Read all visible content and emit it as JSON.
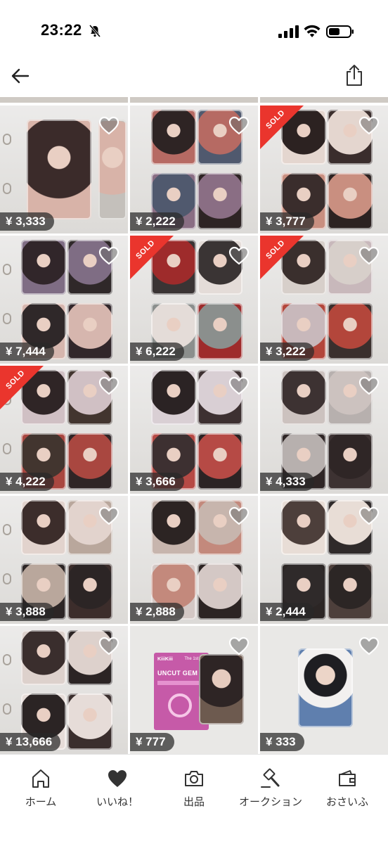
{
  "status_bar": {
    "time": "23:22"
  },
  "colors": {
    "sold_ribbon": "#ea352d",
    "price_tag_bg": "#3a3a3a",
    "heart_fill": "#ffffff",
    "heart_outline": "#666666"
  },
  "listings": [
    {
      "price": "¥ 3,333",
      "sold": false
    },
    {
      "price": "¥ 2,222",
      "sold": false
    },
    {
      "price": "¥ 3,777",
      "sold": true
    },
    {
      "price": "¥ 7,444",
      "sold": false
    },
    {
      "price": "¥ 6,222",
      "sold": true
    },
    {
      "price": "¥ 3,222",
      "sold": true
    },
    {
      "price": "¥ 4,222",
      "sold": true
    },
    {
      "price": "¥ 3,666",
      "sold": false
    },
    {
      "price": "¥ 4,333",
      "sold": false
    },
    {
      "price": "¥ 3,888",
      "sold": false
    },
    {
      "price": "¥ 2,888",
      "sold": false
    },
    {
      "price": "¥ 2,444",
      "sold": false
    },
    {
      "price": "¥ 13,666",
      "sold": false
    },
    {
      "price": "¥ 777",
      "sold": false
    },
    {
      "price": "¥ 333",
      "sold": false
    }
  ],
  "sold_label": "SOLD",
  "album": {
    "brand": "KiiiKiii",
    "ep": "The 1st EP",
    "title": "UNCUT GEM"
  },
  "tabs": [
    {
      "label": "ホーム",
      "icon": "home-icon"
    },
    {
      "label": "いいね！",
      "icon": "heart-icon"
    },
    {
      "label": "出品",
      "icon": "camera-icon"
    },
    {
      "label": "オークション",
      "icon": "gavel-icon"
    },
    {
      "label": "おさいふ",
      "icon": "wallet-icon"
    }
  ]
}
